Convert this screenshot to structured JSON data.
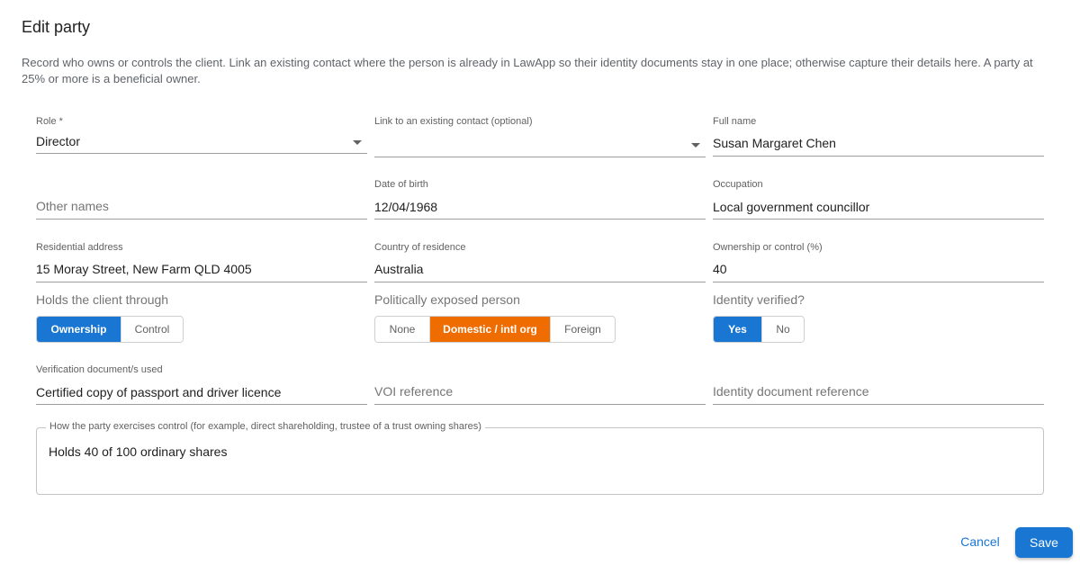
{
  "dialog": {
    "title": "Edit party",
    "intro": "Record who owns or controls the client. Link an existing contact where the person is already in LawApp so their identity documents stay in one place; otherwise capture their details here. A party at 25% or more is a beneficial owner."
  },
  "fields": {
    "role": {
      "label": "Role *",
      "value": "Director",
      "icon": "chevron-down-icon"
    },
    "contact": {
      "label": "Link to an existing contact (optional)",
      "value": "",
      "icon": "chevron-down-icon"
    },
    "full_name": {
      "label": "Full name",
      "value": "Susan Margaret Chen"
    },
    "other_names": {
      "placeholder": "Other names"
    },
    "dob": {
      "label": "Date of birth",
      "value": "12/04/1968"
    },
    "occupation": {
      "label": "Occupation",
      "value": "Local government councillor"
    },
    "address": {
      "label": "Residential address",
      "value": "15 Moray Street, New Farm QLD 4005"
    },
    "country": {
      "label": "Country of residence",
      "value": "Australia"
    },
    "ownership": {
      "label": "Ownership or control (%)",
      "value": "40"
    },
    "verification_doc": {
      "label": "Verification document/s used",
      "value": "Certified copy of passport and driver licence"
    },
    "voi_ref": {
      "placeholder": "VOI reference"
    },
    "id_doc_ref": {
      "placeholder": "Identity document reference"
    },
    "control_desc": {
      "label": "How the party exercises control (for example, direct shareholding, trustee of a trust owning shares)",
      "value": "Holds 40 of 100 ordinary shares"
    }
  },
  "toggles": {
    "holds_through": {
      "label": "Holds the client through",
      "options": [
        "Ownership",
        "Control"
      ],
      "selected": "Ownership"
    },
    "pep": {
      "label": "Politically exposed person",
      "options": [
        "None",
        "Domestic / intl org",
        "Foreign"
      ],
      "selected": "Domestic / intl org"
    },
    "identity_verified": {
      "label": "Identity verified?",
      "options": [
        "Yes",
        "No"
      ],
      "selected": "Yes"
    }
  },
  "actions": {
    "cancel": "Cancel",
    "save": "Save"
  },
  "colors": {
    "primary": "#1976d2",
    "pep_selected": "#ef6c00"
  }
}
